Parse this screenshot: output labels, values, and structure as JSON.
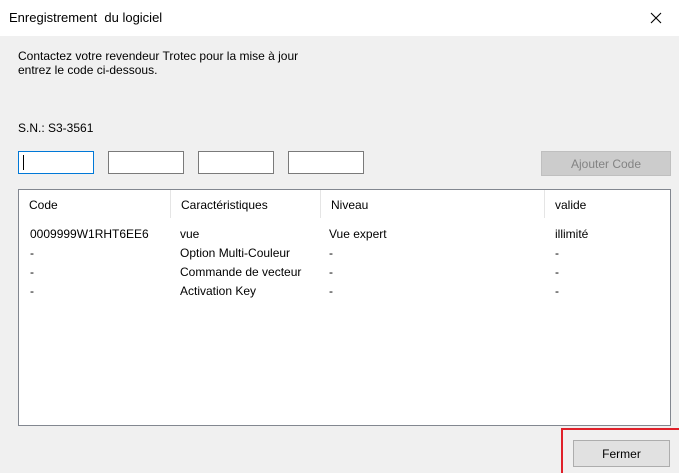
{
  "window": {
    "title": "Enregistrement  du logiciel",
    "close_icon": "close-icon"
  },
  "instructions": {
    "line1": "Contactez votre revendeur Trotec pour la mise à jour",
    "line2": "entrez le code ci-dessous."
  },
  "serial": {
    "text": "S.N.: S3-3561"
  },
  "code_inputs": {
    "values": [
      "",
      "",
      "",
      ""
    ]
  },
  "add_button": {
    "label": "Ajouter Code",
    "enabled": false
  },
  "table": {
    "columns": [
      "Code",
      "Caractéristiques",
      "Niveau",
      "valide"
    ],
    "rows": [
      [
        "0009999W1RHT6EE6",
        "vue",
        "Vue expert",
        "illimité"
      ],
      [
        "-",
        "Option Multi-Couleur",
        "-",
        "-"
      ],
      [
        "-",
        "Commande de vecteur",
        "-",
        "-"
      ],
      [
        "-",
        "Activation Key",
        "-",
        "-"
      ]
    ]
  },
  "close_button": {
    "label": "Fermer"
  },
  "colors": {
    "highlight": "#e0202a",
    "focus_border": "#0078d7"
  }
}
